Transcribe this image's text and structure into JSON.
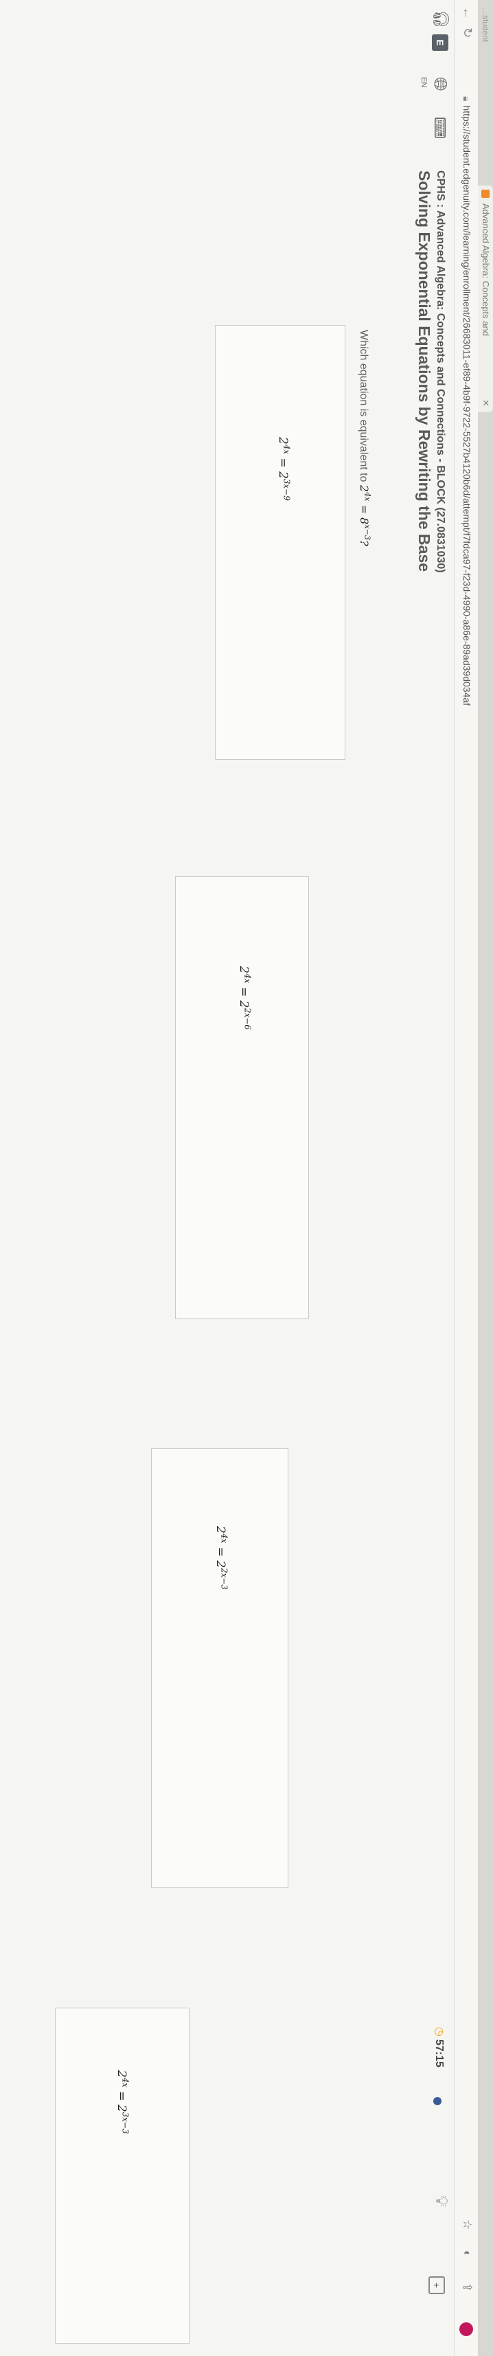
{
  "browser": {
    "prev_tab_label": "…student",
    "tab_title": "Advanced Algebra: Concepts and",
    "url": "https://student.edgenuity.com/learning/enrollment/26683011-ef89-4b9f-9722-5527b4120b6d/attempt/f7fdca97-f23d-4990-a86e-89ad39d034af"
  },
  "rail": {
    "logo": "E",
    "language": "EN"
  },
  "header": {
    "course": "CPHS : Advanced Algebra: Concepts and Connections - BLOCK (27.0831030)",
    "lesson": "Solving Exponential Equations by Rewriting the Base",
    "timer": "57:15"
  },
  "question": {
    "text": "Which equation is equivalent to",
    "eq_base_left": "2",
    "eq_exp_left": "4x",
    "eq_mid": " = 8",
    "eq_exp_right": "x−3",
    "eq_tail": "?"
  },
  "choices": [
    {
      "base": "2",
      "exp_left": "4x",
      "mid": " = 2",
      "exp_right": "3x−9"
    },
    {
      "base": "2",
      "exp_left": "4x",
      "mid": " = 2",
      "exp_right": "2x−6"
    },
    {
      "base": "2",
      "exp_left": "4x",
      "mid": " = 2",
      "exp_right": "2x−3"
    },
    {
      "base": "2",
      "exp_left": "4x",
      "mid": " = 2",
      "exp_right": "3x−3"
    }
  ],
  "icons": {
    "back": "arrow-left-icon",
    "reload": "reload-icon",
    "lock": "lock-icon",
    "timer": "clock-icon",
    "hint": "lightbulb-icon",
    "toolbox": "toolbox-icon",
    "globe": "globe-icon",
    "headphones": "headphones-icon",
    "keyboard": "keyboard-icon"
  },
  "colors": {
    "accent_timer": "#f2a21b",
    "status_dot": "#3a5b98",
    "profile": "#c2185b",
    "favicon": "#ef8a2a"
  }
}
